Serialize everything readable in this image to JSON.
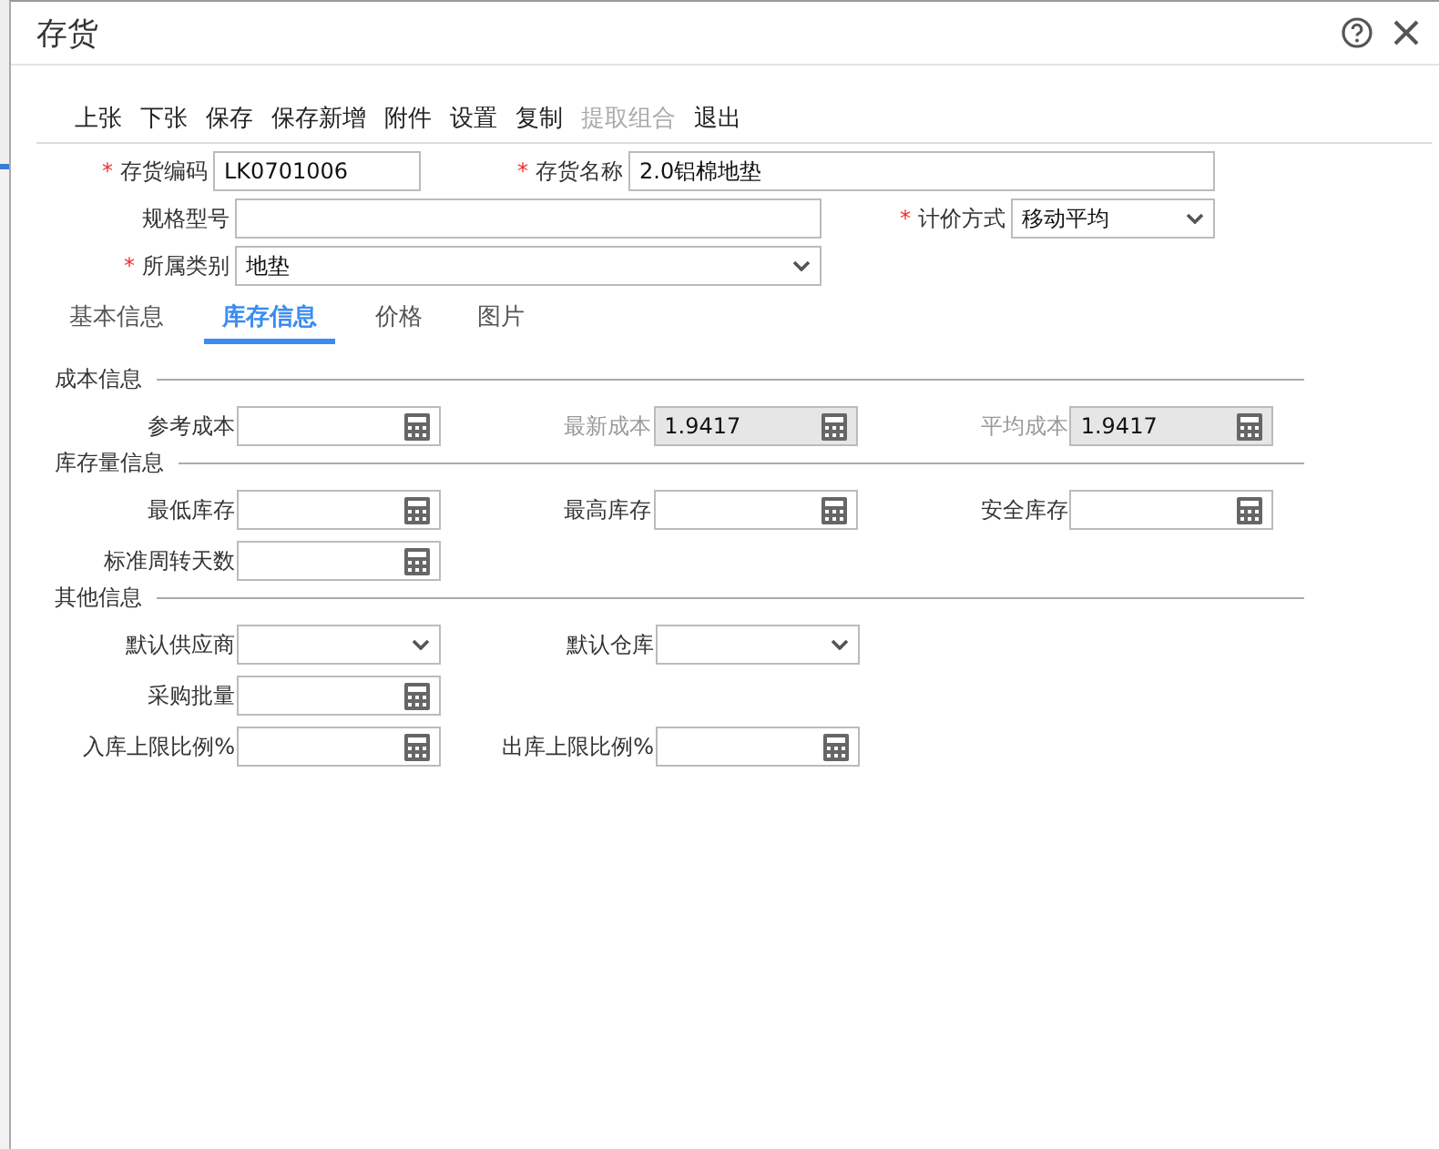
{
  "window": {
    "title": "存货"
  },
  "toolbar": [
    {
      "label": "上张",
      "disabled": false
    },
    {
      "label": "下张",
      "disabled": false
    },
    {
      "label": "保存",
      "disabled": false
    },
    {
      "label": "保存新增",
      "disabled": false
    },
    {
      "label": "附件",
      "disabled": false
    },
    {
      "label": "设置",
      "disabled": false
    },
    {
      "label": "复制",
      "disabled": false
    },
    {
      "label": "提取组合",
      "disabled": true
    },
    {
      "label": "退出",
      "disabled": false
    }
  ],
  "header_rows": [
    [
      {
        "mark": "*",
        "label": "存货编码",
        "kind": "text",
        "value": "LK0701006"
      },
      {
        "mark": "*",
        "label": "存货名称",
        "kind": "text",
        "value": "2.0铝棉地垫"
      }
    ],
    [
      {
        "label": "规格型号",
        "kind": "text"
      },
      {
        "mark": "*",
        "label": "计价方式",
        "kind": "select",
        "value": "移动平均"
      }
    ],
    [
      {
        "mark": "*",
        "label": "所属类别",
        "kind": "select",
        "value": "地垫"
      }
    ]
  ],
  "tabs": [
    {
      "label": "基本信息",
      "selected": false
    },
    {
      "label": "库存信息",
      "selected": true
    },
    {
      "label": "价格",
      "selected": false
    },
    {
      "label": "图片",
      "selected": false
    }
  ],
  "sections": [
    {
      "title": "成本信息",
      "rows": [
        [
          {
            "label": "参考成本",
            "kind": "number",
            "disabled": false
          },
          {
            "label": "最新成本",
            "kind": "number",
            "value": "1.9417",
            "disabled": true
          },
          {
            "label": "平均成本",
            "kind": "number",
            "value": "1.9417",
            "disabled": true
          }
        ]
      ]
    },
    {
      "title": "库存量信息",
      "rows": [
        [
          {
            "label": "最低库存",
            "kind": "number",
            "disabled": false
          },
          {
            "label": "最高库存",
            "kind": "number",
            "disabled": false
          },
          {
            "label": "安全库存",
            "kind": "number",
            "disabled": false
          }
        ],
        [
          {
            "label": "标准周转天数",
            "kind": "number",
            "disabled": false
          }
        ]
      ]
    },
    {
      "title": "其他信息",
      "rows": [
        [
          {
            "label": "默认供应商",
            "kind": "select",
            "disabled": false
          },
          {
            "label": "默认仓库",
            "kind": "select",
            "disabled": false
          }
        ],
        [
          {
            "label": "采购批量",
            "kind": "number",
            "disabled": false
          }
        ],
        [
          {
            "label": "入库上限比例%",
            "kind": "number",
            "disabled": false
          },
          {
            "label": "出库上限比例%",
            "kind": "number",
            "disabled": false
          }
        ]
      ]
    }
  ]
}
